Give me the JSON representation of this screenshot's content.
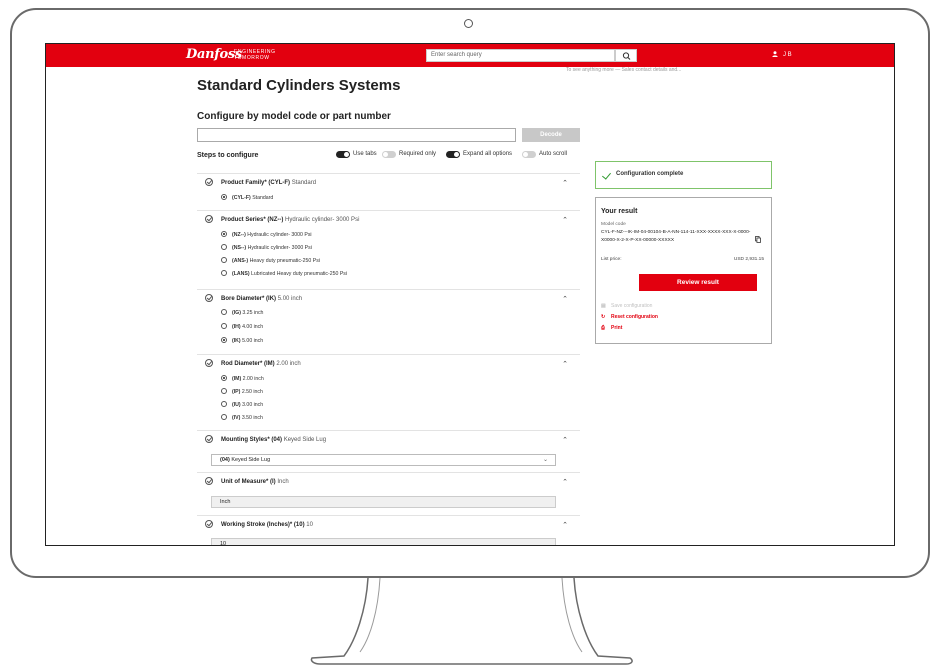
{
  "header": {
    "logo": "Danfoss",
    "tagline_1": "ENGINEERING",
    "tagline_2": "TOMORROW",
    "search_placeholder": "Enter search query",
    "user": "J B",
    "subline": "To see anything more — Sales contact details and..."
  },
  "page": {
    "title": "Standard Cylinders Systems",
    "configure_title": "Configure by model code or part number",
    "decode_label": "Decode",
    "steps_label": "Steps to configure",
    "toggles": [
      {
        "label": "Use tabs",
        "on": true
      },
      {
        "label": "Required only",
        "on": false
      },
      {
        "label": "Expand all options",
        "on": true
      },
      {
        "label": "Auto scroll",
        "on": false
      }
    ]
  },
  "steps": [
    {
      "name": "Product Family*",
      "value_code": "(CYL-F)",
      "value_text": "Standard",
      "options": [
        {
          "code": "(CYL-F)",
          "text": "Standard",
          "selected": true
        }
      ]
    },
    {
      "name": "Product Series*",
      "value_code": "(NZ--)",
      "value_text": "Hydraulic cylinder- 3000 Psi",
      "options": [
        {
          "code": "(NZ--)",
          "text": "Hydraulic cylinder- 3000 Psi",
          "selected": true
        },
        {
          "code": "(NS--)",
          "text": "Hydraulic cylinder- 3000 Psi",
          "selected": false
        },
        {
          "code": "(ANS-)",
          "text": "Heavy duty pneumatic-250 Psi",
          "selected": false
        },
        {
          "code": "(LANS)",
          "text": "Lubricated Heavy duty pneumatic-250 Psi",
          "selected": false
        }
      ]
    },
    {
      "name": "Bore Diameter*",
      "value_code": "(IK)",
      "value_text": "5.00 inch",
      "options": [
        {
          "code": "(IG)",
          "text": "3.25 inch",
          "selected": false
        },
        {
          "code": "(IH)",
          "text": "4.00 inch",
          "selected": false
        },
        {
          "code": "(IK)",
          "text": "5.00 inch",
          "selected": true
        }
      ]
    },
    {
      "name": "Rod Diameter*",
      "value_code": "(IM)",
      "value_text": "2.00 inch",
      "options": [
        {
          "code": "(IM)",
          "text": "2.00 inch",
          "selected": true
        },
        {
          "code": "(IP)",
          "text": "2.50 inch",
          "selected": false
        },
        {
          "code": "(IU)",
          "text": "3.00 inch",
          "selected": false
        },
        {
          "code": "(IV)",
          "text": "3.50 inch",
          "selected": false
        }
      ]
    },
    {
      "name": "Mounting Styles*",
      "value_code": "(04)",
      "value_text": "Keyed Side Lug",
      "select_code": "(04)",
      "select_text": "Keyed Side Lug"
    },
    {
      "name": "Unit of Measure*",
      "value_code": "(I)",
      "value_text": "Inch",
      "input_value": "Inch"
    },
    {
      "name": "Working Stroke (Inches)*",
      "value_code": "(10)",
      "value_text": "10",
      "input_value": "10"
    }
  ],
  "result": {
    "status": "Configuration complete",
    "title": "Your result",
    "model_code_label": "Model code",
    "model_code": "CYL-F-NZ---IK-IM-04-00104-B-A-NN-114-11-XXX-XXXX-XXX-X-0000-X0000-X-2-X-P-XX-00000-XXXXX",
    "list_price_label": "List price:",
    "list_price": "USD 2,931.15",
    "review_label": "Review result",
    "save_label": "Save configuration",
    "reset_label": "Reset configuration",
    "print_label": "Print"
  },
  "colors": {
    "brand_red": "#e2000f",
    "complete_green": "#2e9a2e"
  }
}
